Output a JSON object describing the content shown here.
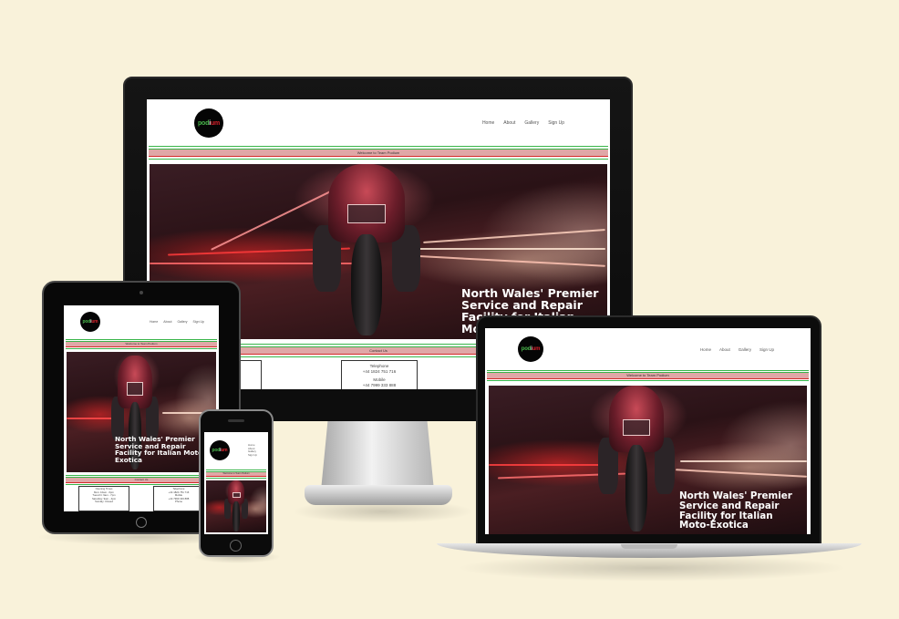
{
  "site": {
    "logo_text": {
      "p1": "pod",
      "p2": "i",
      "p3": "um"
    },
    "nav": [
      "Home",
      "About",
      "Gallery",
      "Sign Up"
    ],
    "welcome": "Welcome to Team Podium",
    "hero_headline": "North Wales' Premier Service and Repair Facility for Italian Moto-Exotica",
    "contact_title": "Contact Us",
    "contact": {
      "telephone_label": "Telephone",
      "telephone": "+44 1824 751 716",
      "mobile_label": "Mobile",
      "mobile": "+44 7999 333 888",
      "opening_label": "Opening Times",
      "opening_times": [
        "Mon: 10am - 6pm",
        "Tues-Fri: 9am - 7pm",
        "Saturday: 9am - 4pm",
        "Sunday: Closed"
      ],
      "phone_label": "Phone"
    }
  },
  "colors": {
    "background": "#f9f2da",
    "accent_green": "#39b54a",
    "accent_red": "#d42a2a",
    "welcome_bar": "#e0a7a7"
  }
}
